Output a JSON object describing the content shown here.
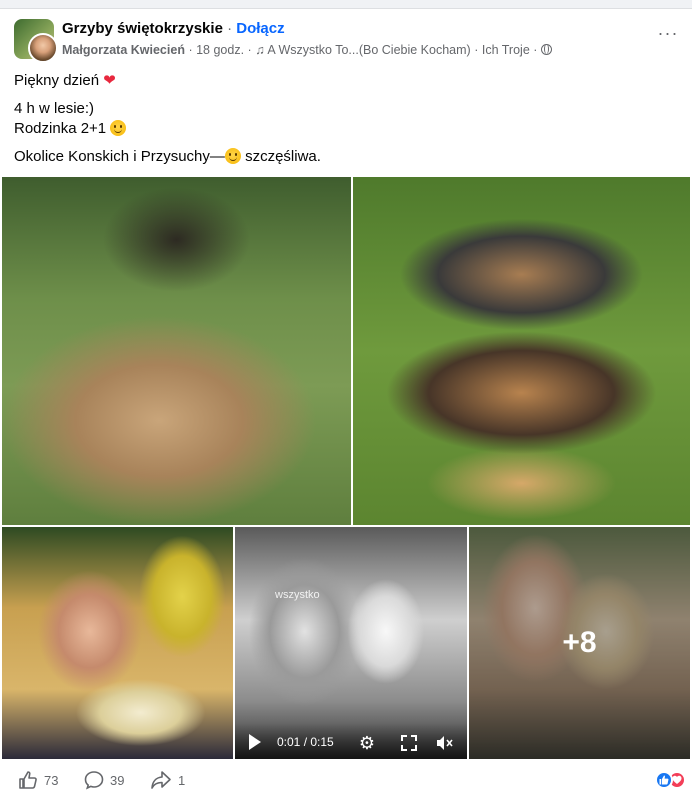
{
  "header": {
    "group_name": "Grzyby świętokrzyskie",
    "separator": "·",
    "join_label": "Dołącz",
    "author": "Małgorzata Kwiecień",
    "time": "18 godz.",
    "music": "A Wszystko To...(Bo Ciebie Kocham)",
    "artist": "Ich Troje",
    "more_label": "···"
  },
  "post": {
    "line1": "Piękny dzień",
    "line2": "4 h w lesie:)",
    "line3": "Rodzinka 2+1",
    "line4_before": "Okolice Konskich i Przysuchy—",
    "line4_after": "szczęśliwa."
  },
  "media": {
    "video_time": "0:01 / 0:15",
    "video_watermark": "wszystko",
    "more_photos": "+8"
  },
  "actions": {
    "likes": "73",
    "comments": "39",
    "shares": "1"
  },
  "colors": {
    "accent": "#0866ff",
    "like_blue": "#1877f2",
    "love_red": "#f33e58",
    "muted": "#65676b"
  }
}
